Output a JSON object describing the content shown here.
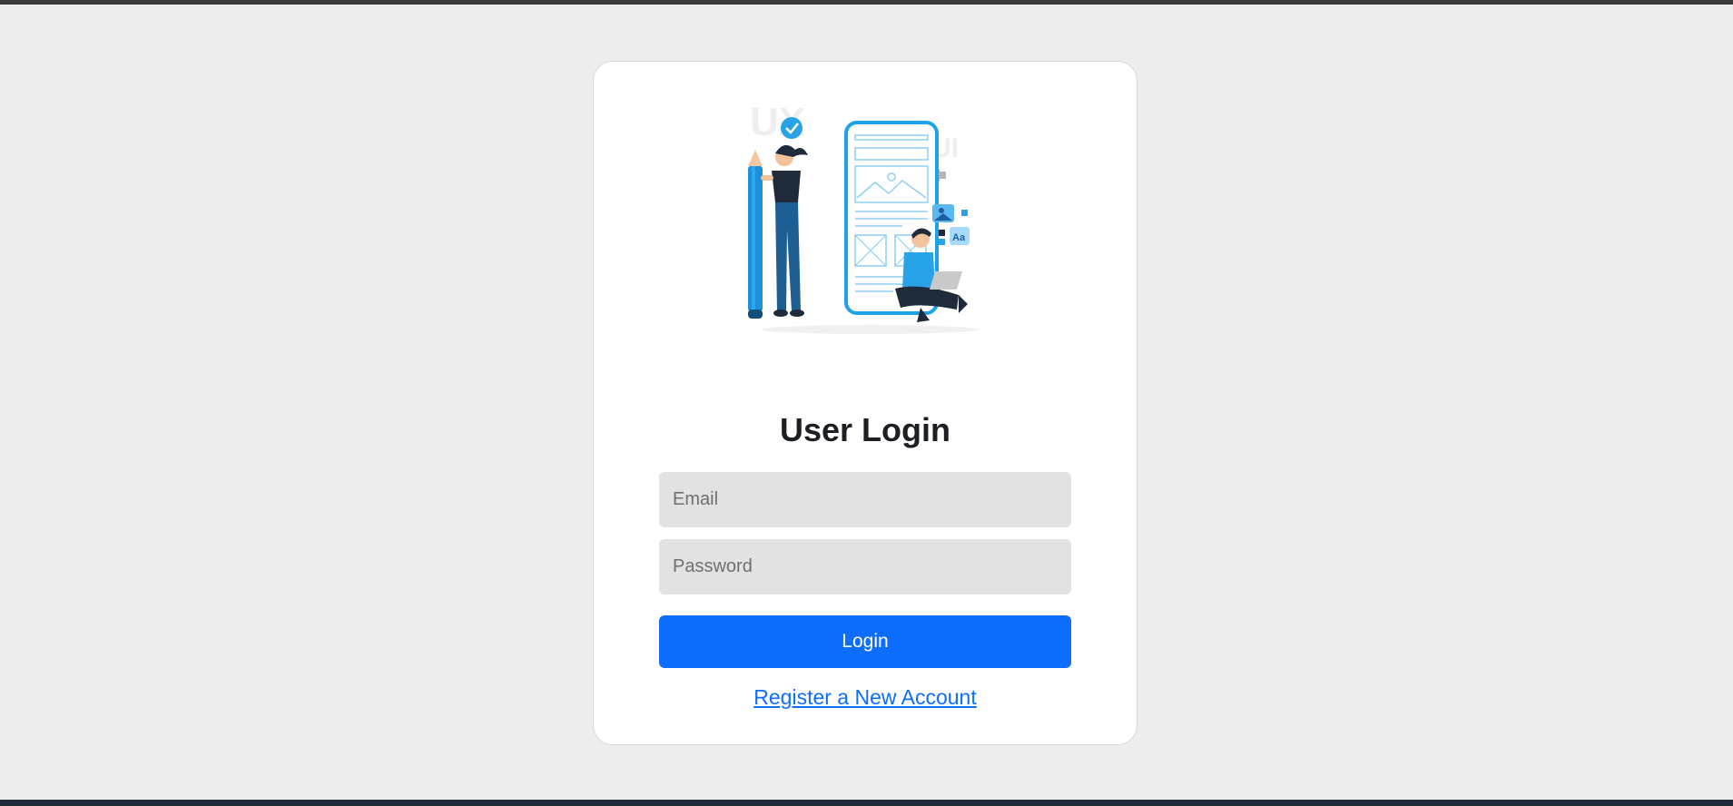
{
  "login": {
    "title": "User Login",
    "email_placeholder": "Email",
    "password_placeholder": "Password",
    "submit_label": "Login",
    "register_link": "Register a New Account"
  },
  "illustration": {
    "name": "ui-ux-design-illustration",
    "watermark_left": "UX",
    "watermark_right": "UI",
    "badge_text": "Aa"
  },
  "colors": {
    "background": "#ededed",
    "card": "#ffffff",
    "field": "#e3e2e3",
    "accent": "#0d6efd",
    "title": "#1c1f23",
    "illustration_blue": "#29a3e8"
  }
}
